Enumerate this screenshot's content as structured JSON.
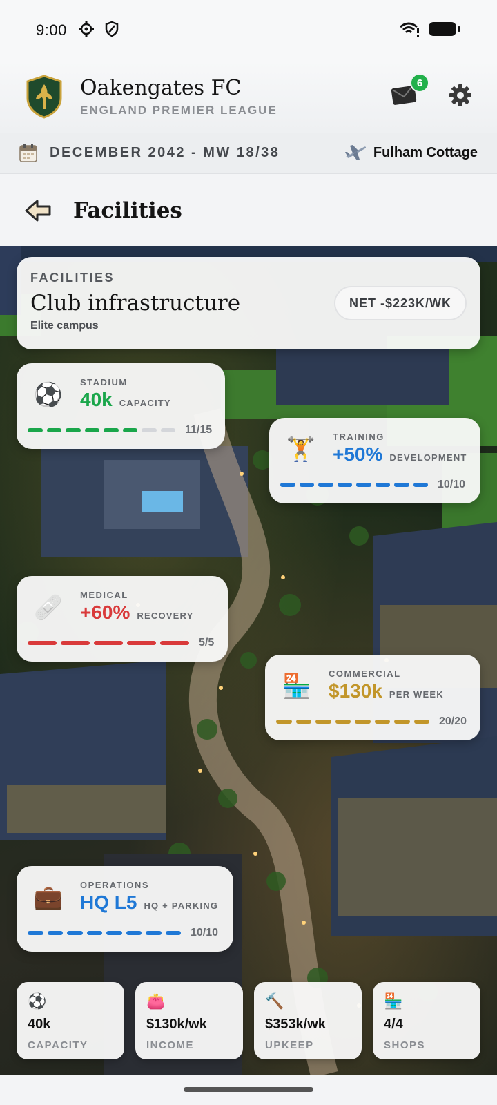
{
  "status_bar": {
    "time": "9:00"
  },
  "header": {
    "club_name": "Oakengates FC",
    "league": "ENGLAND PREMIER LEAGUE",
    "inbox_count": "6"
  },
  "date_bar": {
    "date": "DECEMBER 2042 - MW 18/38",
    "next_opponent": "Fulham Cottage"
  },
  "page": {
    "title": "Facilities"
  },
  "overview": {
    "eyebrow": "FACILITIES",
    "title": "Club infrastructure",
    "subtitle": "Elite campus",
    "net": "NET -$223K/WK"
  },
  "facilities": [
    {
      "label": "STADIUM",
      "value": "40k",
      "unit": "CAPACITY",
      "level": "11/15",
      "level_current": 11,
      "level_max": 15,
      "color": "#1aa64a",
      "icon": "soccer-ball-icon",
      "glyph": "⚽"
    },
    {
      "label": "TRAINING",
      "value": "+50%",
      "unit": "DEVELOPMENT",
      "level": "10/10",
      "level_current": 10,
      "level_max": 10,
      "color": "#1f78d6",
      "icon": "dumbbell-icon",
      "glyph": "🏋"
    },
    {
      "label": "MEDICAL",
      "value": "+60%",
      "unit": "RECOVERY",
      "level": "5/5",
      "level_current": 5,
      "level_max": 5,
      "color": "#d93a3a",
      "icon": "bandage-icon",
      "glyph": "🩹"
    },
    {
      "label": "COMMERCIAL",
      "value": "$130k",
      "unit": "PER WEEK",
      "level": "20/20",
      "level_current": 20,
      "level_max": 20,
      "color": "#c2962a",
      "icon": "shop-icon",
      "glyph": "🏪"
    },
    {
      "label": "OPERATIONS",
      "value": "HQ L5",
      "unit": "HQ + PARKING",
      "level": "10/10",
      "level_current": 10,
      "level_max": 10,
      "color": "#1f78d6",
      "icon": "briefcase-icon",
      "glyph": "💼"
    }
  ],
  "stats": [
    {
      "icon": "soccer-ball-icon",
      "glyph": "⚽",
      "value": "40k",
      "label": "CAPACITY"
    },
    {
      "icon": "wallet-icon",
      "glyph": "👛",
      "value": "$130k/wk",
      "label": "INCOME"
    },
    {
      "icon": "hammer-icon",
      "glyph": "🔨",
      "value": "$353k/wk",
      "label": "UPKEEP"
    },
    {
      "icon": "shop-icon",
      "glyph": "🏪",
      "value": "4/4",
      "label": "SHOPS"
    }
  ]
}
